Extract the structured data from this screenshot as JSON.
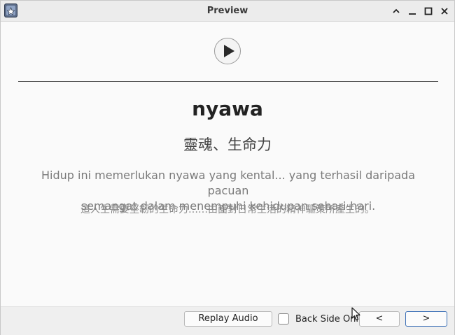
{
  "window": {
    "title": "Preview",
    "controls": [
      "chevron-up-icon",
      "minimize-icon",
      "maximize-icon",
      "close-icon"
    ]
  },
  "card": {
    "word": "nyawa",
    "meaning": "靈魂、生命力",
    "example_line1": "Hidup ini memerlukan nyawa yang kental... yang terhasil daripada pacuan",
    "example_line2": "semangat dalam menempuhi kehidupan sehari-hari.",
    "translation": "這人生需要堅韌的生命力……由面對日常生活的精神驅策所產生的。"
  },
  "footer": {
    "replay_label": "Replay Audio",
    "back_side_only_label": "Back Side Only",
    "back_side_only_checked": false,
    "prev_label": "<",
    "next_label": ">"
  }
}
